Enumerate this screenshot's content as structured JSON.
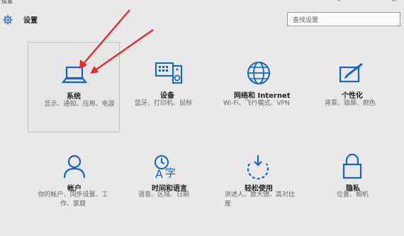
{
  "window": {
    "title": "设置",
    "minimize": "–",
    "close": "×"
  },
  "header": {
    "title": "设置",
    "search_placeholder": "查找设置"
  },
  "tiles": [
    {
      "name": "系统",
      "desc": "显示、通知、应用、电源"
    },
    {
      "name": "设备",
      "desc": "蓝牙、打印机、鼠标"
    },
    {
      "name": "网络和 Internet",
      "desc": "Wi-Fi、飞行模式、VPN"
    },
    {
      "name": "个性化",
      "desc": "背景、锁屏、颜色"
    },
    {
      "name": "帐户",
      "desc": "你的帐户、同步设置、工作、家庭"
    },
    {
      "name": "时间和语言",
      "desc": "语音、区域、日期"
    },
    {
      "name": "轻松使用",
      "desc": "讲述人、放大镜、高对比度"
    },
    {
      "name": "隐私",
      "desc": "位置、相机"
    }
  ],
  "colors": {
    "accent": "#1464c8",
    "arrow": "#e8292f",
    "bg": "#e9e9e9"
  },
  "icons": [
    "gear-icon",
    "laptop-icon",
    "devices-icon",
    "globe-icon",
    "personalize-icon",
    "user-icon",
    "time-language-icon",
    "ease-access-icon",
    "lock-icon"
  ]
}
